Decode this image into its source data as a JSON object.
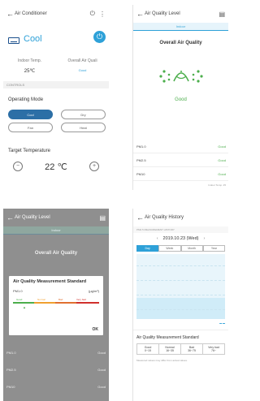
{
  "screen1": {
    "title": "Air Conditioner",
    "mode_label": "Cool",
    "indoor_temp_label": "Indoor Temp.",
    "indoor_temp_value": "25℃",
    "overall_aq_label": "Overall Air Quali",
    "overall_aq_value": "Good",
    "controls_header": "CONTROLS",
    "operating_mode_label": "Operating Mode",
    "modes": [
      "Cool",
      "Dry",
      "Fan",
      "Heat"
    ],
    "target_temp_label": "Target Temperature",
    "target_temp_value": "22 ℃"
  },
  "screen2": {
    "title": "Air Quality Level",
    "tab_label": "Indoor",
    "overall_title": "Overall Air Quality",
    "status": "Good",
    "pm_rows": [
      {
        "label": "PM1.0",
        "value": "Good"
      },
      {
        "label": "PM2.5",
        "value": "Good"
      },
      {
        "label": "PM10",
        "value": "Good"
      }
    ],
    "footnote": "Indoor Temp. 25"
  },
  "screen3": {
    "title": "Air Quality Level",
    "tab_label": "Indoor",
    "overall_title": "Overall Air Quality",
    "dialog_title": "Air Quality Measurement Standard",
    "dialog_pm": "PM1.0",
    "dialog_unit": "(µg/m³)",
    "levels": [
      "Good",
      "Normal",
      "Bad",
      "Very bad"
    ],
    "ok_label": "OK",
    "pm_rows": [
      {
        "label": "PM1.0",
        "value": "Good"
      },
      {
        "label": "PM2.5",
        "value": "Good"
      },
      {
        "label": "PM10",
        "value": "Good"
      }
    ],
    "colors": {
      "good": "#4cae4c",
      "normal": "#f0a030",
      "bad": "#e07030",
      "very_bad": "#d0302c"
    }
  },
  "screen4": {
    "title": "Air Quality History",
    "subtitle": "PM2.5 MEASUREMENT HISTORY",
    "date": "2019.10.23 (Wed)",
    "periods": [
      "Day",
      "Week",
      "Month",
      "Year"
    ],
    "active_period": "Day",
    "standard_title": "Air Quality Measurement Standard",
    "standard_cells": [
      {
        "level": "Good",
        "range": "0~15"
      },
      {
        "level": "Normal",
        "range": "16~35"
      },
      {
        "level": "Bad",
        "range": "36~75"
      },
      {
        "level": "Very bad",
        "range": "76~"
      }
    ],
    "note": "Measured values may differ from actual values."
  }
}
